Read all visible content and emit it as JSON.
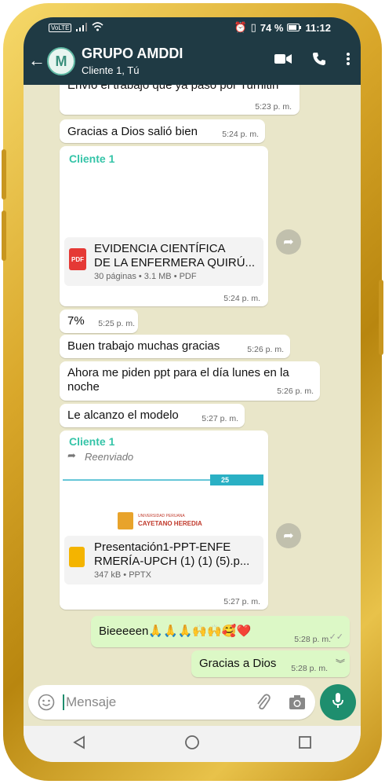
{
  "status": {
    "carrier": "VoLTE",
    "battery": "74 %",
    "time": "11:12"
  },
  "header": {
    "title": "GRUPO AMDDI",
    "subtitle": "Cliente 1, Tú",
    "avatar_letter": "M"
  },
  "messages": {
    "m0": {
      "text": "Envío el trabajo que ya pasó por Turnitin",
      "time": "5:23 p. m."
    },
    "m1": {
      "text": "Gracias a Dios salió bien",
      "time": "5:24 p. m."
    },
    "m2": {
      "sender": "Cliente 1",
      "doc_title_1": "EVIDENCIA CIENTÍFICA",
      "doc_title_2": "DE LA ENFERMERA QUIRÚ...",
      "doc_meta": "30 páginas • 3.1 MB • PDF",
      "doc_type": "PDF",
      "time": "5:24 p. m."
    },
    "m3": {
      "text": "7%",
      "time": "5:25 p. m."
    },
    "m4": {
      "text": "Buen trabajo muchas gracias",
      "time": "5:26 p. m."
    },
    "m5": {
      "text_1": "Ahora me piden ppt para el día lunes en la",
      "text_2": "noche",
      "time": "5:26 p. m."
    },
    "m6": {
      "text": "Le alcanzo el modelo",
      "time": "5:27 p. m."
    },
    "m7": {
      "sender": "Cliente 1",
      "forwarded": "Reenviado",
      "slide_badge": "25",
      "slide_logo_top": "UNIVERSIDAD PERUANA",
      "slide_logo": "CAYETANO HEREDIA",
      "doc_title_1": "Presentación1-PPT-ENFE",
      "doc_title_2": "RMERÍA-UPCH (1) (1) (5).p...",
      "doc_meta": "347 kB • PPTX",
      "time": "5:27 p. m."
    },
    "m8": {
      "text": "Bieeeeen🙏🙏🙏🙌🙌🥰❤️",
      "time": "5:28 p. m."
    },
    "m9": {
      "text": "Gracias a Dios",
      "time": "5:28 p. m."
    }
  },
  "input": {
    "placeholder": "Mensaje"
  },
  "colors": {
    "header": "#1f3a44",
    "outgoing": "#dcf8c6",
    "accent": "#1e8e6e",
    "sender": "#35c4a8"
  }
}
